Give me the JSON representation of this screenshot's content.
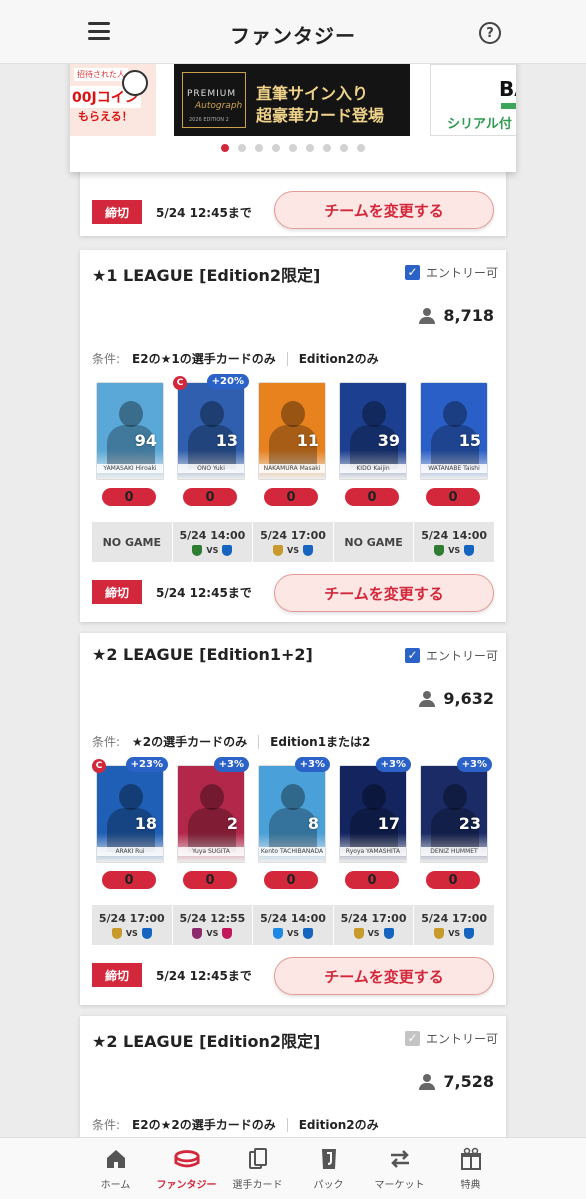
{
  "header": {
    "title": "ファンタジー",
    "help": "?"
  },
  "banners": [
    {
      "invite": "招待された人",
      "coin": "00Jコイン",
      "receive": "もらえる！"
    },
    {
      "premium": "PREMIUM",
      "autograph": "Autograph",
      "edition": "2026 EDITION 2",
      "line1": "直筆サイン入り",
      "line2": "超豪華カード登場"
    },
    {
      "code": "BA",
      "serial": "シリアル付"
    }
  ],
  "carousel": {
    "total": 9,
    "active": 0
  },
  "partial_card": {
    "deadline_tag": "締切",
    "deadline_time": "5/24 12:45まで",
    "change_label": "チームを変更する"
  },
  "leagues": [
    {
      "title": "★1 LEAGUE [Edition2限定]",
      "entry_label": "エントリー可",
      "participants": "8,718",
      "cond_label": "条件:",
      "cond1": "E2の★1の選手カードのみ",
      "cond2": "Edition2のみ",
      "players": [
        {
          "number": "94",
          "name": "YAMASAKI Hiroaki",
          "color": "#5aa8d8",
          "captain": false,
          "bonus": "",
          "score": "0"
        },
        {
          "number": "13",
          "name": "ONO Yuki",
          "color": "#2f5fae",
          "captain": true,
          "bonus": "+20%",
          "score": "0"
        },
        {
          "number": "11",
          "name": "NAKAMURA Masaki",
          "color": "#e8821e",
          "captain": false,
          "bonus": "",
          "score": "0"
        },
        {
          "number": "39",
          "name": "KIDO Kaijin",
          "color": "#1c3f8f",
          "captain": false,
          "bonus": "",
          "score": "0"
        },
        {
          "number": "15",
          "name": "WATANABE Taishi",
          "color": "#2a5fc8",
          "captain": false,
          "bonus": "",
          "score": "0"
        }
      ],
      "games": [
        {
          "time": "",
          "nogame": "NO GAME",
          "home": "",
          "away": "",
          "vs": ""
        },
        {
          "time": "5/24 14:00",
          "nogame": "",
          "home": "#2e7d32",
          "away": "#1565c0",
          "vs": "VS"
        },
        {
          "time": "5/24 17:00",
          "nogame": "",
          "home": "#c79a2b",
          "away": "#1565c0",
          "vs": "VS"
        },
        {
          "time": "",
          "nogame": "NO GAME",
          "home": "",
          "away": "",
          "vs": ""
        },
        {
          "time": "5/24 14:00",
          "nogame": "",
          "home": "#2e7d32",
          "away": "#1565c0",
          "vs": "VS"
        }
      ],
      "deadline_tag": "締切",
      "deadline_time": "5/24 12:45まで",
      "change_label": "チームを変更する"
    },
    {
      "title": "★2 LEAGUE [Edition1+2]",
      "entry_label": "エントリー可",
      "participants": "9,632",
      "cond_label": "条件:",
      "cond1": "★2の選手カードのみ",
      "cond2": "Edition1または2",
      "players": [
        {
          "number": "18",
          "name": "ARAKI Rui",
          "color": "#1f5fb6",
          "captain": true,
          "bonus": "+23%",
          "score": "0"
        },
        {
          "number": "2",
          "name": "Yuya SUGITA",
          "color": "#b3284a",
          "captain": false,
          "bonus": "+3%",
          "score": "0"
        },
        {
          "number": "8",
          "name": "Kento TACHIBANADA",
          "color": "#4aa0d8",
          "captain": false,
          "bonus": "+3%",
          "score": "0"
        },
        {
          "number": "17",
          "name": "Ryoya YAMASHITA",
          "color": "#13245e",
          "captain": false,
          "bonus": "+3%",
          "score": "0"
        },
        {
          "number": "23",
          "name": "DENIZ HUMMET",
          "color": "#1a2b66",
          "captain": false,
          "bonus": "+3%",
          "score": "0"
        }
      ],
      "games": [
        {
          "time": "5/24 17:00",
          "nogame": "",
          "home": "#c79a2b",
          "away": "#1565c0",
          "vs": "VS"
        },
        {
          "time": "5/24 12:55",
          "nogame": "",
          "home": "#8e2a6b",
          "away": "#c2185b",
          "vs": "VS"
        },
        {
          "time": "5/24 14:00",
          "nogame": "",
          "home": "#1e88e5",
          "away": "#1565c0",
          "vs": "VS"
        },
        {
          "time": "5/24 17:00",
          "nogame": "",
          "home": "#c79a2b",
          "away": "#1565c0",
          "vs": "VS"
        },
        {
          "time": "5/24 17:00",
          "nogame": "",
          "home": "#c79a2b",
          "away": "#1565c0",
          "vs": "VS"
        }
      ],
      "deadline_tag": "締切",
      "deadline_time": "5/24 12:45まで",
      "change_label": "チームを変更する"
    },
    {
      "title": "★2 LEAGUE [Edition2限定]",
      "entry_label": "エントリー可",
      "participants": "7,528",
      "cond_label": "条件:",
      "cond1": "E2の★2の選手カードのみ",
      "cond2": "Edition2のみ"
    }
  ],
  "bottom_nav": [
    {
      "label": "ホーム",
      "icon": "home-icon",
      "active": false
    },
    {
      "label": "ファンタジー",
      "icon": "stadium-icon",
      "active": true
    },
    {
      "label": "選手カード",
      "icon": "cards-icon",
      "active": false
    },
    {
      "label": "パック",
      "icon": "pack-icon",
      "active": false
    },
    {
      "label": "マーケット",
      "icon": "exchange-icon",
      "active": false
    },
    {
      "label": "特典",
      "icon": "gift-icon",
      "active": false
    }
  ],
  "colors": {
    "accent": "#d3283b",
    "entry_check": "#2a62c7",
    "bonus": "#2a62c7"
  }
}
